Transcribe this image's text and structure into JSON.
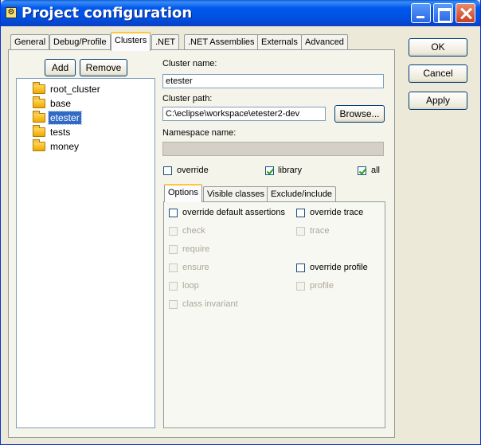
{
  "window": {
    "title": "Project configuration",
    "icon": "gear-app-icon"
  },
  "tabs": [
    {
      "label": "General"
    },
    {
      "label": "Debug/Profile"
    },
    {
      "label": "Clusters"
    },
    {
      "label": ".NET"
    },
    {
      ".label": "",
      "label": ".NET Assemblies"
    },
    {
      "label": "Externals"
    },
    {
      "label": "Advanced"
    }
  ],
  "dialog_buttons": {
    "ok": "OK",
    "cancel": "Cancel",
    "apply": "Apply"
  },
  "cluster_buttons": {
    "add": "Add",
    "remove": "Remove"
  },
  "tree": {
    "items": [
      {
        "label": "root_cluster",
        "selected": false
      },
      {
        "label": "base",
        "selected": false
      },
      {
        "label": "etester",
        "selected": true
      },
      {
        "label": "tests",
        "selected": false
      },
      {
        "label": "money",
        "selected": false
      }
    ]
  },
  "fields": {
    "cluster_name_label": "Cluster name:",
    "cluster_name_value": "etester",
    "cluster_path_label": "Cluster path:",
    "cluster_path_value": "C:\\eclipse\\workspace\\etester2-dev",
    "browse": "Browse...",
    "namespace_label": "Namespace name:",
    "namespace_value": ""
  },
  "flags": {
    "override": {
      "label": "override",
      "checked": false
    },
    "library": {
      "label": "library",
      "checked": true
    },
    "all": {
      "label": "all",
      "checked": true
    }
  },
  "inner_tabs": [
    {
      "label": "Options"
    },
    {
      "label": "Visible classes"
    },
    {
      "label": "Exclude/include"
    }
  ],
  "options": {
    "override_default_assertions": "override default assertions",
    "check": "check",
    "require": "require",
    "ensure": "ensure",
    "loop": "loop",
    "class_invariant": "class invariant",
    "override_trace": "override trace",
    "trace": "trace",
    "override_profile": "override profile",
    "profile": "profile"
  }
}
